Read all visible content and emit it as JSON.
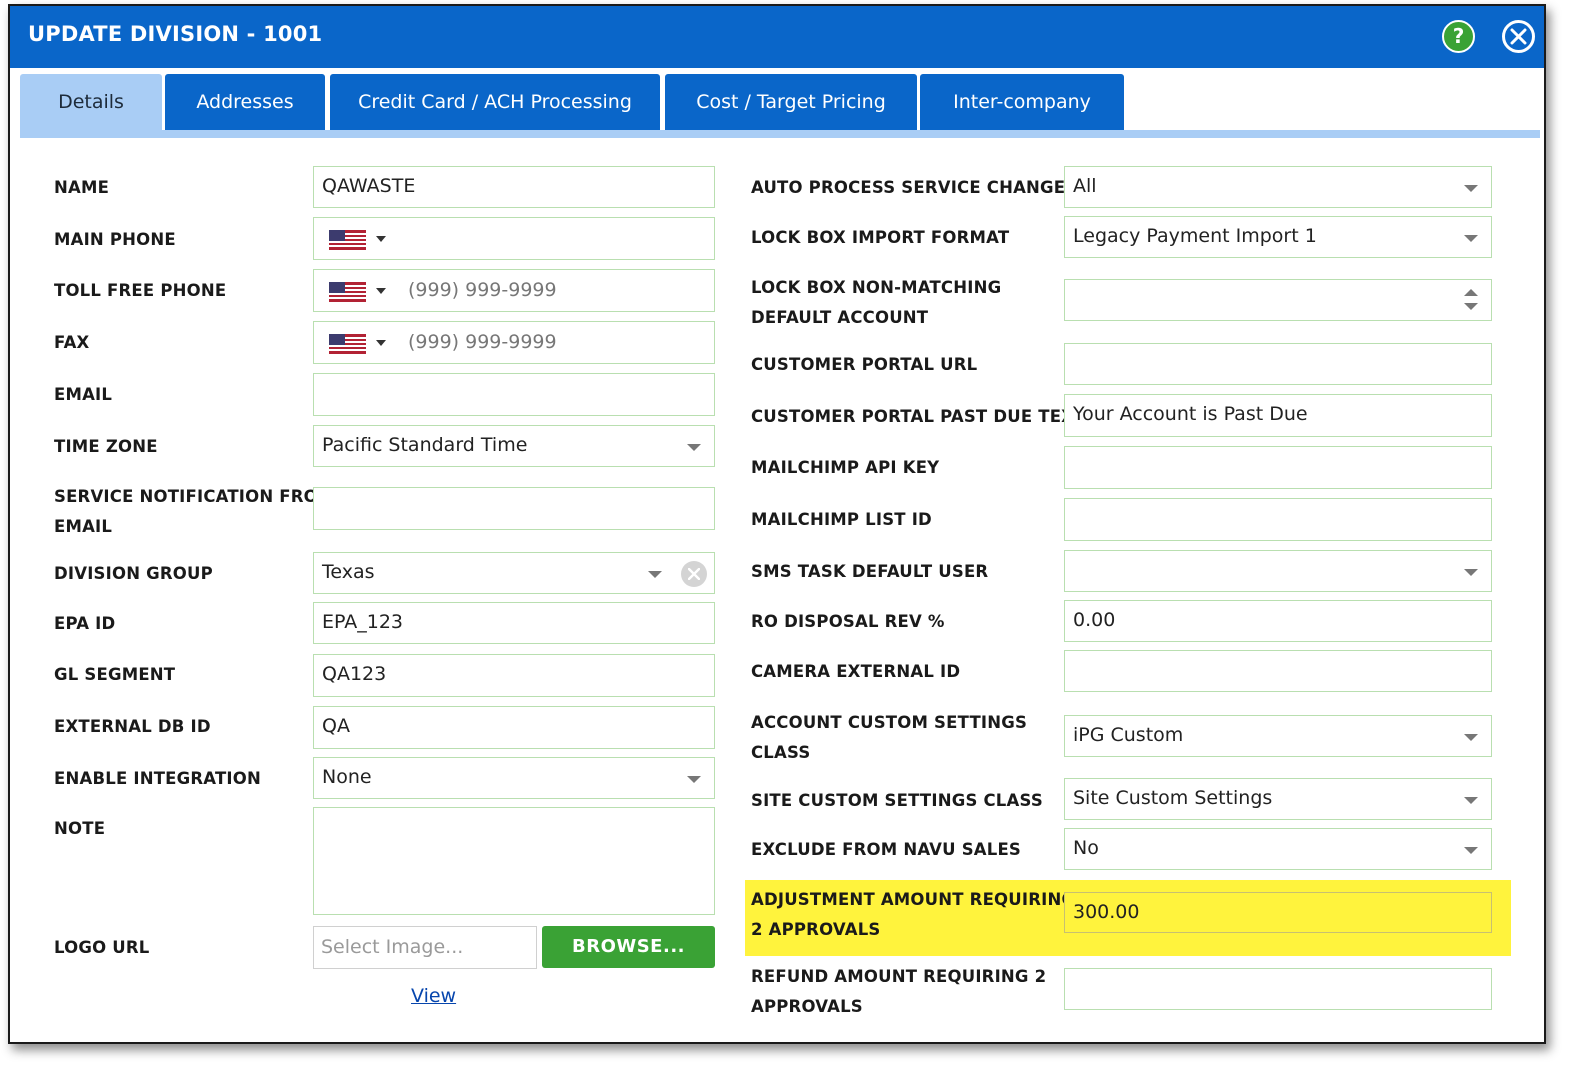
{
  "dialog": {
    "title": "UPDATE DIVISION - 1001",
    "help_label": "?"
  },
  "tabs": [
    {
      "label": "Details",
      "active": true
    },
    {
      "label": "Addresses",
      "active": false
    },
    {
      "label": "Credit Card / ACH Processing",
      "active": false
    },
    {
      "label": "Cost / Target Pricing",
      "active": false
    },
    {
      "label": "Inter-company",
      "active": false
    }
  ],
  "left": {
    "name": {
      "line1": "NAME",
      "value": "QAWASTE"
    },
    "main_phone": {
      "line1": "MAIN PHONE"
    },
    "toll_free_phone": {
      "line1": "TOLL FREE PHONE",
      "placeholder": "(999) 999-9999"
    },
    "fax": {
      "line1": "FAX",
      "placeholder": "(999) 999-9999"
    },
    "email": {
      "line1": "EMAIL"
    },
    "time_zone": {
      "line1": "TIME ZONE",
      "value": "Pacific Standard Time"
    },
    "service_notification": {
      "line1": "SERVICE NOTIFICATION FROM",
      "line2": "EMAIL"
    },
    "division_group": {
      "line1": "DIVISION GROUP",
      "value": "Texas"
    },
    "epa_id": {
      "line1": "EPA ID",
      "value": "EPA_123"
    },
    "gl_segment": {
      "line1": "GL SEGMENT",
      "value": "QA123"
    },
    "external_db_id": {
      "line1": "EXTERNAL DB ID",
      "value": "QA"
    },
    "enable_integration": {
      "line1": "ENABLE INTEGRATION",
      "value": "None"
    },
    "note": {
      "line1": "NOTE"
    },
    "logo_url": {
      "line1": "LOGO URL",
      "placeholder": "Select Image...",
      "browse_label": "BROWSE...",
      "view_label": "View"
    }
  },
  "right": {
    "auto_process": {
      "line1": "AUTO PROCESS SERVICE CHANGES",
      "value": "All"
    },
    "lock_box_format": {
      "line1": "LOCK BOX IMPORT FORMAT",
      "value": "Legacy Payment Import 1"
    },
    "lock_box_nonmatching": {
      "line1": "LOCK BOX NON-MATCHING",
      "line2": "DEFAULT ACCOUNT"
    },
    "portal_url": {
      "line1": "CUSTOMER PORTAL URL"
    },
    "portal_past_due": {
      "line1": "CUSTOMER PORTAL PAST DUE TEXT",
      "value": "Your Account is Past Due"
    },
    "mailchimp_api_key": {
      "line1": "MAILCHIMP API KEY"
    },
    "mailchimp_list_id": {
      "line1": "MAILCHIMP LIST ID"
    },
    "sms_task_user": {
      "line1": "SMS TASK DEFAULT USER"
    },
    "ro_disposal_rev": {
      "line1": "RO DISPOSAL REV %",
      "value": "0.00"
    },
    "camera_external_id": {
      "line1": "CAMERA EXTERNAL ID"
    },
    "account_custom_settings": {
      "line1": "ACCOUNT CUSTOM SETTINGS",
      "line2": "CLASS",
      "value": "iPG Custom"
    },
    "site_custom_settings": {
      "line1": "SITE CUSTOM SETTINGS CLASS",
      "value": "Site Custom Settings"
    },
    "exclude_navu_sales": {
      "line1": "EXCLUDE FROM NAVU SALES",
      "value": "No"
    },
    "adjustment_amount": {
      "line1": "ADJUSTMENT AMOUNT REQUIRING",
      "line2": "2 APPROVALS",
      "value": "300.00"
    },
    "refund_amount": {
      "line1": "REFUND AMOUNT REQUIRING 2",
      "line2": "APPROVALS"
    }
  },
  "colors": {
    "titlebar": "#0a66c9",
    "tab_active": "#a9cdf5",
    "browse_button": "#3aa235",
    "highlight": "#fff33d",
    "field_border": "#b9dfb0"
  }
}
